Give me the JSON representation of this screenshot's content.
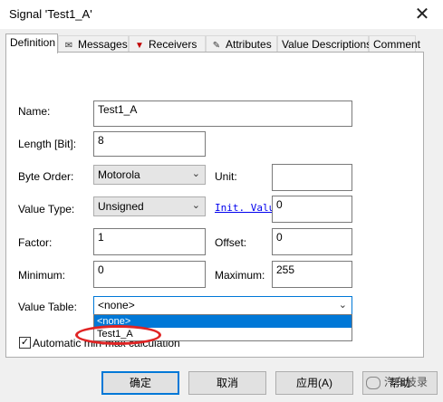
{
  "window": {
    "title": "Signal 'Test1_A'",
    "close_glyph": "✕"
  },
  "tabs": [
    {
      "label": "Definition",
      "icon": ""
    },
    {
      "label": "Messages",
      "icon": "envelope-icon"
    },
    {
      "label": "Receivers",
      "icon": "receiver-icon"
    },
    {
      "label": "Attributes",
      "icon": "pin-icon"
    },
    {
      "label": "Value Descriptions",
      "icon": ""
    },
    {
      "label": "Comment",
      "icon": ""
    }
  ],
  "form": {
    "name_label": "Name:",
    "name_value": "Test1_A",
    "length_label": "Length [Bit]:",
    "length_value": "8",
    "byte_order_label": "Byte Order:",
    "byte_order_value": "Motorola",
    "unit_label": "Unit:",
    "unit_value": "",
    "value_type_label": "Value Type:",
    "value_type_value": "Unsigned",
    "init_value_label": "Init. Value:",
    "init_value_value": "0",
    "factor_label": "Factor:",
    "factor_value": "1",
    "offset_label": "Offset:",
    "offset_value": "0",
    "minimum_label": "Minimum:",
    "minimum_value": "0",
    "maximum_label": "Maximum:",
    "maximum_value": "255",
    "value_table_label": "Value Table:",
    "value_table_value": "<none>",
    "value_table_options": [
      "<none>",
      "Test1_A"
    ],
    "auto_minmax_label": "Automatic min-max calculation",
    "auto_minmax_checked": true
  },
  "buttons": {
    "ok": "确定",
    "cancel": "取消",
    "apply": "应用(A)",
    "help": "帮助"
  },
  "watermark": {
    "text": "汽车技录"
  },
  "colors": {
    "selection": "#0078d7",
    "highlight_circle": "#e02424"
  }
}
